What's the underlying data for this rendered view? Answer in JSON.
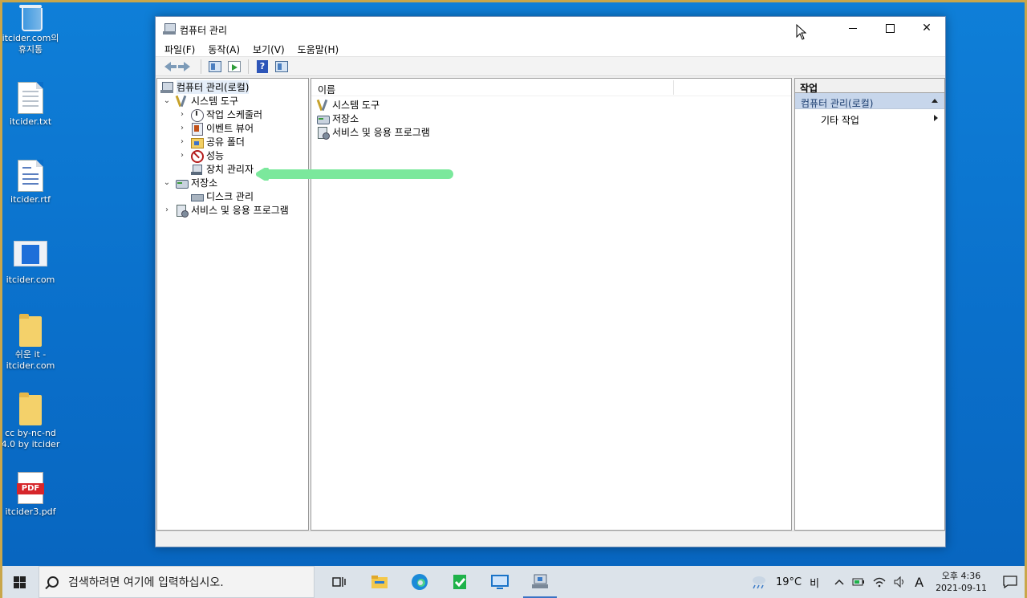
{
  "desktop": {
    "icons": [
      {
        "label": "itcider.com의 휴지통",
        "icon": "recycle-bin-icon"
      },
      {
        "label": "itcider.txt",
        "icon": "text-file-icon"
      },
      {
        "label": "itcider.rtf",
        "icon": "rtf-file-icon"
      },
      {
        "label": "itcider.com",
        "icon": "web-shortcut-icon"
      },
      {
        "label": "쉬운 it - itcider.com",
        "icon": "folder-icon"
      },
      {
        "label": "cc by-nc-nd 4.0 by itcider",
        "icon": "folder-icon"
      },
      {
        "label": "itcider3.pdf",
        "icon": "pdf-file-icon"
      }
    ],
    "pdf_badge": "PDF"
  },
  "window": {
    "title": "컴퓨터 관리",
    "menu": [
      "파일(F)",
      "동작(A)",
      "보기(V)",
      "도움말(H)"
    ],
    "toolbar": {
      "help_glyph": "?"
    },
    "tree": {
      "root": "컴퓨터 관리(로컬)",
      "system_tools": "시스템 도구",
      "task_scheduler": "작업 스케줄러",
      "event_viewer": "이벤트 뷰어",
      "shared_folders": "공유 폴더",
      "performance": "성능",
      "device_manager": "장치 관리자",
      "storage": "저장소",
      "disk_management": "디스크 관리",
      "services_apps": "서비스 및 응용 프로그램",
      "expanded_glyph": "⌄",
      "collapsed_glyph": "›"
    },
    "list": {
      "column_name": "이름",
      "items": [
        "시스템 도구",
        "저장소",
        "서비스 및 응용 프로그램"
      ]
    },
    "actions": {
      "header": "작업",
      "selected": "컴퓨터 관리(로컬)",
      "more": "기타 작업"
    },
    "close_glyph": "✕"
  },
  "annotation": {
    "arrow_color": "#7be89c"
  },
  "taskbar": {
    "search_placeholder": "검색하려면 여기에 입력하십시오.",
    "weather_temp": "19°C",
    "weather_text": "비",
    "ime": "A",
    "time": "오후 4:36",
    "date": "2021-09-11"
  },
  "colors": {
    "desktop": "#0a78d4",
    "selection": "#c7d6eb",
    "taskbar": "#dce3ea"
  }
}
